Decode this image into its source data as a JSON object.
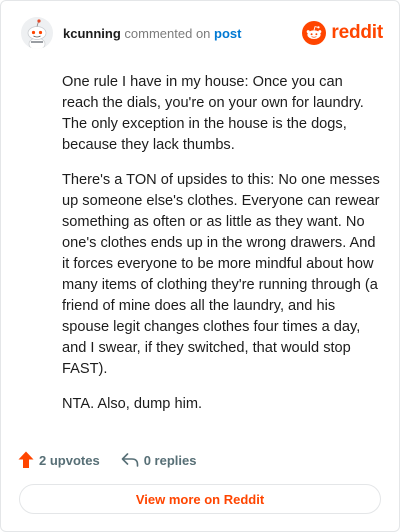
{
  "header": {
    "username": "kcunning",
    "action_text": "commented on",
    "post_link": "post",
    "logo_text": "reddit",
    "avatar_icon": "snoo-avatar-icon",
    "logo_icon": "reddit-snoo-icon"
  },
  "comment": {
    "paragraphs": [
      "One rule I have in my house: Once you can reach the dials, you're on your own for laundry. The only exception in the house is the dogs, because they lack thumbs.",
      "There's a TON of upsides to this: No one messes up someone else's clothes. Everyone can rewear something as often or as little as they want. No one's clothes ends up in the wrong drawers. And it forces everyone to be more mindful about how many items of clothing they're running through (a friend of mine does all the laundry, and his spouse legit changes clothes four times a day, and I swear, if they switched, that would stop FAST).",
      "NTA. Also, dump him."
    ]
  },
  "actions": {
    "upvotes_label": "2 upvotes",
    "replies_label": "0 replies",
    "upvote_icon": "upvote-arrow-icon",
    "reply_icon": "reply-arrow-icon"
  },
  "footer": {
    "view_more_label": "View more on Reddit"
  },
  "colors": {
    "brand": "#ff4500",
    "link": "#0079d3",
    "text": "#1c1c1c",
    "muted": "#576f76"
  }
}
